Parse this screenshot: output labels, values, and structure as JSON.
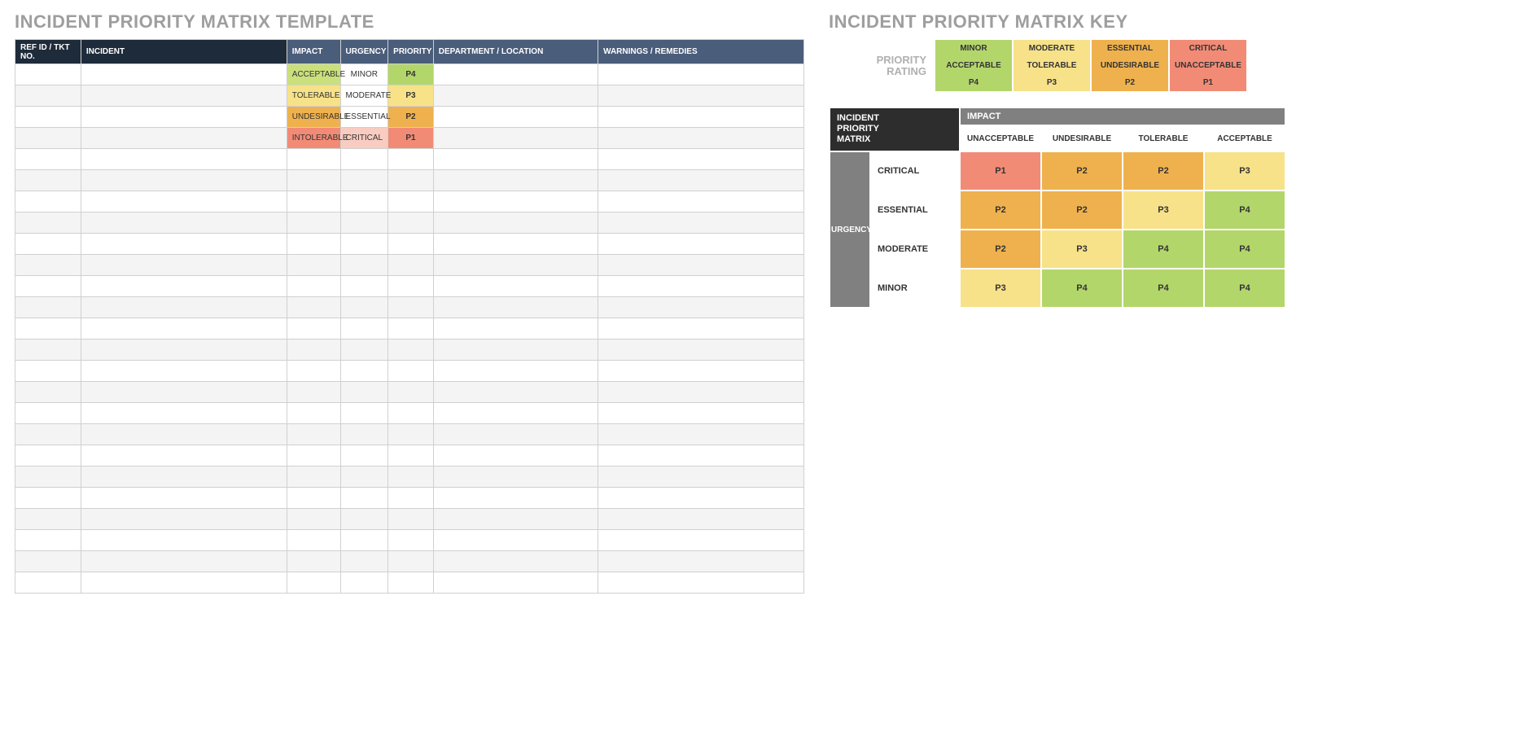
{
  "left": {
    "title": "INCIDENT PRIORITY MATRIX TEMPLATE",
    "headers": [
      "REF ID / TKT NO.",
      "INCIDENT",
      "IMPACT",
      "URGENCY",
      "PRIORITY",
      "DEPARTMENT / LOCATION",
      "WARNINGS / REMEDIES"
    ],
    "rows": [
      {
        "impact": "ACCEPTABLE",
        "impactCls": "c-lgreen",
        "urgency": "MINOR",
        "urgencyCls": "c-white",
        "priority": "P4",
        "priorityCls": "c-green"
      },
      {
        "impact": "TOLERABLE",
        "impactCls": "c-lyellow",
        "urgency": "MODERATE",
        "urgencyCls": "c-white",
        "priority": "P3",
        "priorityCls": "c-lyellow"
      },
      {
        "impact": "UNDESIRABLE",
        "impactCls": "c-orange",
        "urgency": "ESSENTIAL",
        "urgencyCls": "c-white",
        "priority": "P2",
        "priorityCls": "c-orange"
      },
      {
        "impact": "INTOLERABLE",
        "impactCls": "c-red",
        "urgency": "CRITICAL",
        "urgencyCls": "c-palered",
        "priority": "P1",
        "priorityCls": "c-red"
      }
    ],
    "emptyRows": 21
  },
  "right": {
    "title": "INCIDENT PRIORITY MATRIX KEY",
    "ratingLabel1": "PRIORITY",
    "ratingLabel2": "RATING",
    "ratingCols": [
      {
        "top": "MINOR",
        "mid": "ACCEPTABLE",
        "bot": "P4",
        "cls": "c-green"
      },
      {
        "top": "MODERATE",
        "mid": "TOLERABLE",
        "bot": "P3",
        "cls": "c-lyellow"
      },
      {
        "top": "ESSENTIAL",
        "mid": "UNDESIRABLE",
        "bot": "P2",
        "cls": "c-orange"
      },
      {
        "top": "CRITICAL",
        "mid": "UNACCEPTABLE",
        "bot": "P1",
        "cls": "c-red"
      }
    ],
    "matrix": {
      "cornerL1": "INCIDENT",
      "cornerL2": "PRIORITY",
      "cornerL3": "MATRIX",
      "impactLabel": "IMPACT",
      "impactCols": [
        "UNACCEPTABLE",
        "UNDESIRABLE",
        "TOLERABLE",
        "ACCEPTABLE"
      ],
      "urgencyLabel": "URGENCY",
      "rows": [
        {
          "label": "CRITICAL",
          "cells": [
            {
              "v": "P1",
              "cls": "c-red"
            },
            {
              "v": "P2",
              "cls": "c-orange"
            },
            {
              "v": "P2",
              "cls": "c-orange"
            },
            {
              "v": "P3",
              "cls": "c-lyellow"
            }
          ]
        },
        {
          "label": "ESSENTIAL",
          "cells": [
            {
              "v": "P2",
              "cls": "c-orange"
            },
            {
              "v": "P2",
              "cls": "c-orange"
            },
            {
              "v": "P3",
              "cls": "c-lyellow"
            },
            {
              "v": "P4",
              "cls": "c-green"
            }
          ]
        },
        {
          "label": "MODERATE",
          "cells": [
            {
              "v": "P2",
              "cls": "c-orange"
            },
            {
              "v": "P3",
              "cls": "c-lyellow"
            },
            {
              "v": "P4",
              "cls": "c-green"
            },
            {
              "v": "P4",
              "cls": "c-green"
            }
          ]
        },
        {
          "label": "MINOR",
          "cells": [
            {
              "v": "P3",
              "cls": "c-lyellow"
            },
            {
              "v": "P4",
              "cls": "c-green"
            },
            {
              "v": "P4",
              "cls": "c-green"
            },
            {
              "v": "P4",
              "cls": "c-green"
            }
          ]
        }
      ]
    }
  }
}
